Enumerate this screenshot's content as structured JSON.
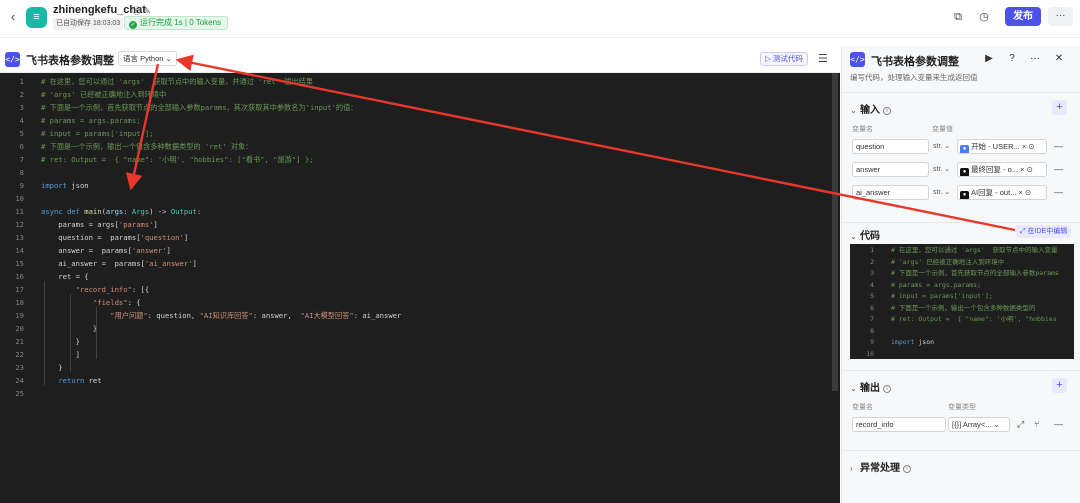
{
  "topbar": {
    "back_icon": "chevron-left-icon",
    "app_name": "zhinengkefu_chat",
    "autosave": "已自动保存 18:03:03",
    "run_status": "运行完成 1s | 0 Tokens",
    "publish_label": "发布"
  },
  "editor": {
    "title": "飞书表格参数调整",
    "language": "语言 Python",
    "test_label": "测试代码",
    "lines": [
      {
        "n": "1",
        "html": "<span class='c-com'># 在这里，您可以通过 'args'  获取节点中的输入变量，并通过 'ret' 输出结果</span>"
      },
      {
        "n": "2",
        "html": "<span class='c-com'># 'args' 已经被正确地注入到环境中</span>"
      },
      {
        "n": "3",
        "html": "<span class='c-com'># 下面是一个示例，首先获取节点的全部输入参数params，其次获取其中参数名为'input'的值：</span>"
      },
      {
        "n": "4",
        "html": "<span class='c-com'># params = args.params;</span>"
      },
      {
        "n": "5",
        "html": "<span class='c-com'># input = params['input'];</span>"
      },
      {
        "n": "6",
        "html": "<span class='c-com'># 下面是一个示例，输出一个包含多种数据类型的 'ret' 对象：</span>"
      },
      {
        "n": "7",
        "html": "<span class='c-com'># ret: Output =  { \"name\": '小明', \"hobbies\": [\"看书\", \"旅游\"] };</span>"
      },
      {
        "n": "8",
        "html": ""
      },
      {
        "n": "9",
        "html": "<span class='c-kw'>import</span> json"
      },
      {
        "n": "10",
        "html": ""
      },
      {
        "n": "11",
        "html": "<span class='c-kw'>async def</span> <span class='c-fn'>main</span>(<span class='c-var'>args</span>: <span class='c-ty'>Args</span>) -> <span class='c-ty'>Output</span>:"
      },
      {
        "n": "12",
        "html": "    params = args[<span class='c-str'>'params'</span>]"
      },
      {
        "n": "13",
        "html": "    question =  params[<span class='c-str'>'question'</span>]"
      },
      {
        "n": "14",
        "html": "    answer =  params[<span class='c-str'>'answer'</span>]"
      },
      {
        "n": "15",
        "html": "    ai_answer =  params[<span class='c-str'>'ai_answer'</span>]"
      },
      {
        "n": "16",
        "html": "    ret = {"
      },
      {
        "n": "17",
        "html": "        <span class='c-str'>\"record_info\"</span>: [{"
      },
      {
        "n": "18",
        "html": "            <span class='c-str'>\"fields\"</span>: {"
      },
      {
        "n": "19",
        "html": "                <span class='c-str'>\"用户问题\"</span>: question, <span class='c-str'>\"AI知识库回答\"</span>: answer,  <span class='c-str'>\"AI大模型回答\"</span>: ai_answer"
      },
      {
        "n": "20",
        "html": "            }"
      },
      {
        "n": "21",
        "html": "        }"
      },
      {
        "n": "22",
        "html": "        ]"
      },
      {
        "n": "23",
        "html": "    }"
      },
      {
        "n": "24",
        "html": "    <span class='c-kw'>return</span> ret"
      },
      {
        "n": "25",
        "html": ""
      }
    ]
  },
  "panel": {
    "title": "飞书表格参数调整",
    "description": "编写代码，处理输入变量来生成返回值",
    "input": {
      "heading": "输入",
      "col_name": "变量名",
      "col_value": "变量值",
      "rows": [
        {
          "name": "question",
          "type": "str.",
          "ref": "开始 - USER...",
          "ref_color": "#4d7cf5"
        },
        {
          "name": "answer",
          "type": "str.",
          "ref": "最终回复 - o...",
          "ref_color": "#111111"
        },
        {
          "name": "ai_answer",
          "type": "str.",
          "ref": "AI回复 - out...",
          "ref_color": "#111111"
        }
      ]
    },
    "code": {
      "heading": "代码",
      "ide_label": "在IDE中编辑",
      "lines": [
        {
          "n": "1",
          "html": "<span class='c-com'># 在这里，您可以通过 'args'  获取节点中的输入变量</span>"
        },
        {
          "n": "2",
          "html": "<span class='c-com'># 'args' 已经被正确地注入到环境中</span>"
        },
        {
          "n": "3",
          "html": "<span class='c-com'># 下面是一个示例，首先获取节点的全部输入参数params</span>"
        },
        {
          "n": "4",
          "html": "<span class='c-com'># params = args.params;</span>"
        },
        {
          "n": "5",
          "html": "<span class='c-com'># input = params['input'];</span>"
        },
        {
          "n": "6",
          "html": "<span class='c-com'># 下面是一个示例，输出一个包含多种数据类型的</span>"
        },
        {
          "n": "7",
          "html": "<span class='c-com'># ret: Output =  { \"name\": '小明', \"hobbies</span>"
        },
        {
          "n": "8",
          "html": ""
        },
        {
          "n": "9",
          "html": "<span class='c-kw'>import</span> json"
        },
        {
          "n": "10",
          "html": ""
        }
      ]
    },
    "output": {
      "heading": "输出",
      "col_name": "变量名",
      "col_type": "变量类型",
      "rows": [
        {
          "name": "record_info",
          "type": "[{}] Array<..."
        }
      ]
    },
    "error": {
      "heading": "异常处理"
    }
  },
  "colors": {
    "accent": "#4d53e8",
    "arrow": "#e8382c"
  }
}
